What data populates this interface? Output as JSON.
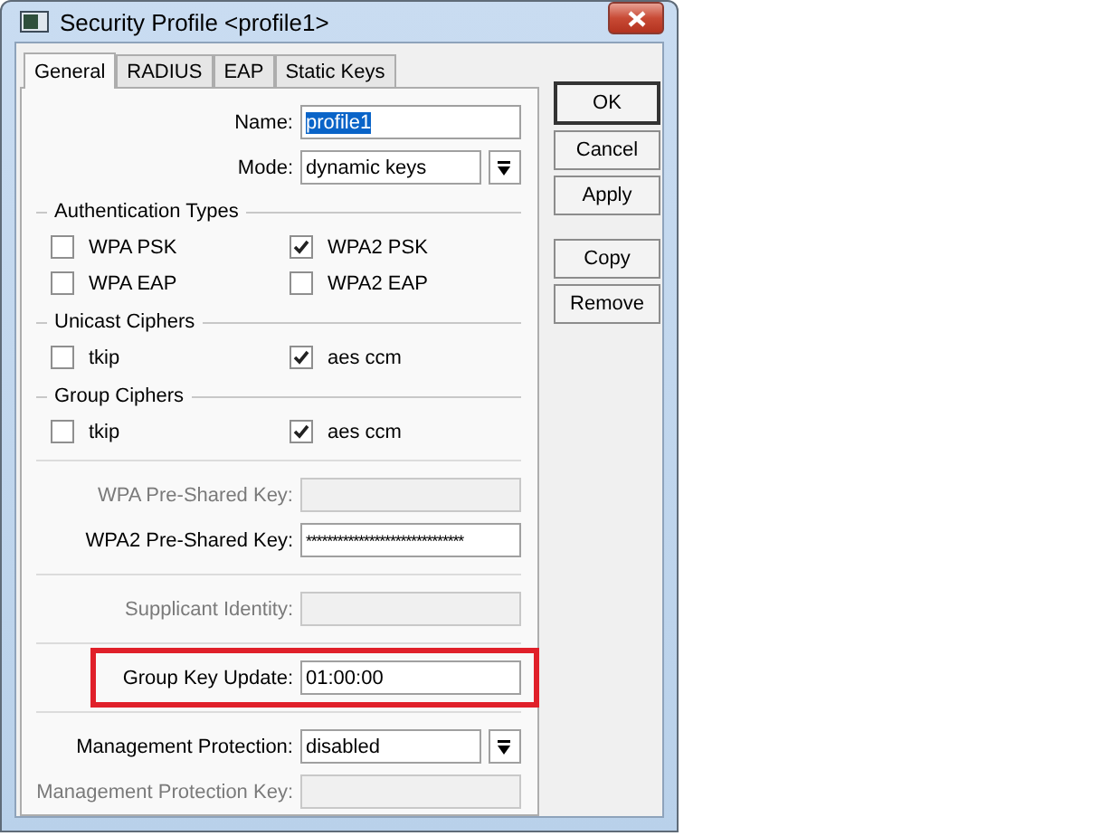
{
  "window": {
    "title": "Security Profile <profile1>"
  },
  "tabs": [
    {
      "label": "General",
      "selected": true
    },
    {
      "label": "RADIUS",
      "selected": false
    },
    {
      "label": "EAP",
      "selected": false
    },
    {
      "label": "Static Keys",
      "selected": false
    }
  ],
  "form": [
    {
      "kind": "field",
      "label": "Name:",
      "value": "profile1",
      "disabled": false,
      "text_selected": true
    },
    {
      "kind": "dropdown",
      "label": "Mode:",
      "value": "dynamic keys",
      "disabled": false
    },
    {
      "kind": "section",
      "title": "Authentication Types",
      "options": [
        {
          "label": "WPA PSK",
          "checked": false
        },
        {
          "label": "WPA2 PSK",
          "checked": true
        },
        {
          "label": "WPA EAP",
          "checked": false
        },
        {
          "label": "WPA2 EAP",
          "checked": false
        }
      ]
    },
    {
      "kind": "section",
      "title": "Unicast Ciphers",
      "options": [
        {
          "label": "tkip",
          "checked": false
        },
        {
          "label": "aes ccm",
          "checked": true
        }
      ]
    },
    {
      "kind": "section",
      "title": "Group Ciphers",
      "options": [
        {
          "label": "tkip",
          "checked": false
        },
        {
          "label": "aes ccm",
          "checked": true
        }
      ]
    },
    {
      "kind": "separator"
    },
    {
      "kind": "field",
      "label": "WPA Pre-Shared Key:",
      "disabled": true
    },
    {
      "kind": "field",
      "label": "WPA2 Pre-Shared Key:",
      "value": "******************************",
      "masked": true,
      "disabled": false
    },
    {
      "kind": "separator"
    },
    {
      "kind": "field",
      "label": "Supplicant Identity:",
      "disabled": true
    },
    {
      "kind": "separator"
    },
    {
      "kind": "field",
      "label": "Group Key Update:",
      "value": "01:00:00",
      "disabled": false,
      "highlighted": true
    },
    {
      "kind": "separator"
    },
    {
      "kind": "dropdown",
      "label": "Management Protection:",
      "value": "disabled",
      "disabled": false
    },
    {
      "kind": "field",
      "label": "Management Protection Key:",
      "disabled": true
    }
  ],
  "buttons": [
    {
      "label": "OK",
      "default": true
    },
    {
      "label": "Cancel",
      "default": false
    },
    {
      "label": "Apply",
      "default": false
    },
    {
      "label": "Copy",
      "default": false
    },
    {
      "label": "Remove",
      "default": false
    }
  ]
}
